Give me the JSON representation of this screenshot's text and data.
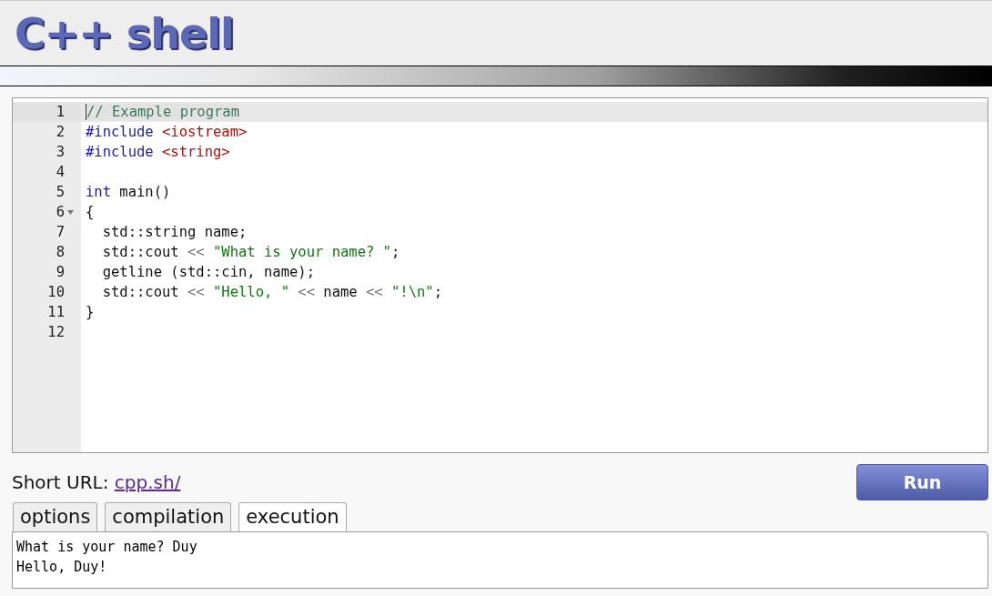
{
  "header": {
    "logo": "C++ shell"
  },
  "editor": {
    "lines": [
      {
        "number": "1",
        "active": true,
        "foldable": false,
        "tokens": [
          {
            "kind": "comment",
            "text": "// Example program"
          }
        ]
      },
      {
        "number": "2",
        "active": false,
        "foldable": false,
        "tokens": [
          {
            "kind": "keyword",
            "text": "#include "
          },
          {
            "kind": "path",
            "text": "<iostream>"
          }
        ]
      },
      {
        "number": "3",
        "active": false,
        "foldable": false,
        "tokens": [
          {
            "kind": "keyword",
            "text": "#include "
          },
          {
            "kind": "path",
            "text": "<string>"
          }
        ]
      },
      {
        "number": "4",
        "active": false,
        "foldable": false
      },
      {
        "number": "5",
        "active": false,
        "foldable": false,
        "tokens": [
          {
            "kind": "keyword",
            "text": "int"
          },
          {
            "kind": "plain",
            "text": " main()"
          }
        ]
      },
      {
        "number": "6",
        "active": false,
        "foldable": true,
        "tokens": [
          {
            "kind": "plain",
            "text": "{"
          }
        ]
      },
      {
        "number": "7",
        "active": false,
        "foldable": false,
        "tokens": [
          {
            "kind": "plain",
            "text": "  std::string name;"
          }
        ]
      },
      {
        "number": "8",
        "active": false,
        "foldable": false,
        "tokens": [
          {
            "kind": "plain",
            "text": "  std::cout "
          },
          {
            "kind": "operator",
            "text": "<<"
          },
          {
            "kind": "string",
            "text": " \"What is your name? \""
          },
          {
            "kind": "plain",
            "text": ";"
          }
        ]
      },
      {
        "number": "9",
        "active": false,
        "foldable": false,
        "tokens": [
          {
            "kind": "plain",
            "text": "  getline (std::cin, name);"
          }
        ]
      },
      {
        "number": "10",
        "active": false,
        "foldable": false,
        "tokens": [
          {
            "kind": "plain",
            "text": "  std::cout "
          },
          {
            "kind": "operator",
            "text": "<<"
          },
          {
            "kind": "string",
            "text": " \"Hello, \" "
          },
          {
            "kind": "operator",
            "text": "<<"
          },
          {
            "kind": "plain",
            "text": " name "
          },
          {
            "kind": "operator",
            "text": "<<"
          },
          {
            "kind": "string",
            "text": " \"!\\n\""
          },
          {
            "kind": "plain",
            "text": ";"
          }
        ]
      },
      {
        "number": "11",
        "active": false,
        "foldable": false,
        "tokens": [
          {
            "kind": "plain",
            "text": "}"
          }
        ]
      },
      {
        "number": "12",
        "active": false,
        "foldable": false
      }
    ]
  },
  "short_url": {
    "label": "Short URL:",
    "link": "cpp.sh/"
  },
  "run_button": "Run",
  "tabs": [
    {
      "label": "options",
      "selected": false
    },
    {
      "label": "compilation",
      "selected": false
    },
    {
      "label": "execution",
      "selected": true
    }
  ],
  "output": [
    "What is your name? Duy",
    "Hello, Duy!"
  ]
}
